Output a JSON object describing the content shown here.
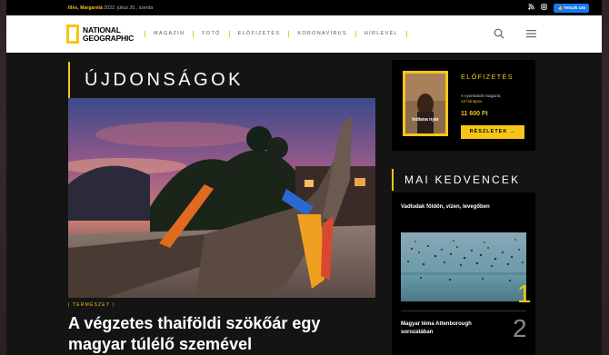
{
  "topbar": {
    "date_name": "Illés, Margarétá",
    "date_rest": " 2022. július 20., szerda",
    "fb_label": "Tetszik 145"
  },
  "header": {
    "logo_line1": "NATIONAL",
    "logo_line2": "GEOGRAPHIC",
    "nav": [
      "MAGAZIN",
      "FOTÓ",
      "ELŐFIZETÉS",
      "KORONAVÍRUS",
      "HÍRLEVÉL"
    ]
  },
  "main": {
    "section_title": "ÚJDONSÁGOK",
    "article": {
      "category": "| TERMÉSZET |",
      "headline": "A végzetes thaiföldi szökőár egy magyar túlélő szemével"
    }
  },
  "sidebar": {
    "subscribe": {
      "title": "ELŐFIZETÉS",
      "cover_title": "Indiana nyár",
      "desc_line1": "A nyomtatott magazin,",
      "desc_line2": "12 hónapra",
      "price": "11 600 Ft",
      "button": "RÉSZLETEK →"
    },
    "favorites": {
      "title": "MAI KEDVENCEK",
      "items": [
        {
          "title": "Vadludak földön, vízen, levegőben",
          "rank": "1"
        },
        {
          "title": "Magyar téma Attenborough sorozatában",
          "rank": "2"
        }
      ]
    }
  },
  "colors": {
    "accent": "#f5c518",
    "page_bg": "#141414",
    "header_bg": "#ffffff"
  },
  "icons": [
    "rss-icon",
    "instagram-icon",
    "facebook-like-icon",
    "search-icon",
    "hamburger-menu-icon"
  ]
}
